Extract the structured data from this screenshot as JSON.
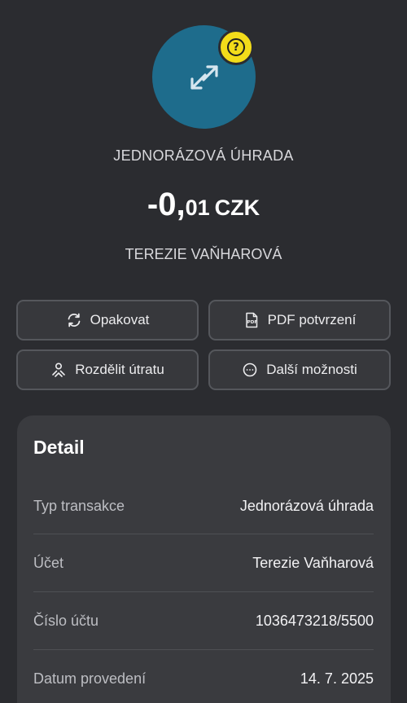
{
  "header": {
    "transaction_type": "JEDNORÁZOVÁ ÚHRADA",
    "amount_integer": "-0,",
    "amount_decimal": "01",
    "currency": "CZK",
    "counterparty": "TEREZIE VAŇHAROVÁ",
    "avatar_icon": "transfer-arrows-icon",
    "avatar_color": "#1e6c8c",
    "help_badge_icon": "question-mark-icon",
    "help_badge_color": "#f3dc1a",
    "help_badge_glyph": "?"
  },
  "actions": [
    {
      "label": "Opakovat",
      "icon": "repeat-icon"
    },
    {
      "label": "PDF potvrzení",
      "icon": "pdf-icon"
    },
    {
      "label": "Rozdělit útratu",
      "icon": "split-icon"
    },
    {
      "label": "Další možnosti",
      "icon": "more-icon"
    }
  ],
  "detail": {
    "title": "Detail",
    "rows": [
      {
        "label": "Typ transakce",
        "value": "Jednorázová úhrada"
      },
      {
        "label": "Účet",
        "value": "Terezie Vaňharová"
      },
      {
        "label": "Číslo účtu",
        "value": "1036473218/5500"
      },
      {
        "label": "Datum provedení",
        "value": "14. 7. 2025"
      }
    ]
  }
}
